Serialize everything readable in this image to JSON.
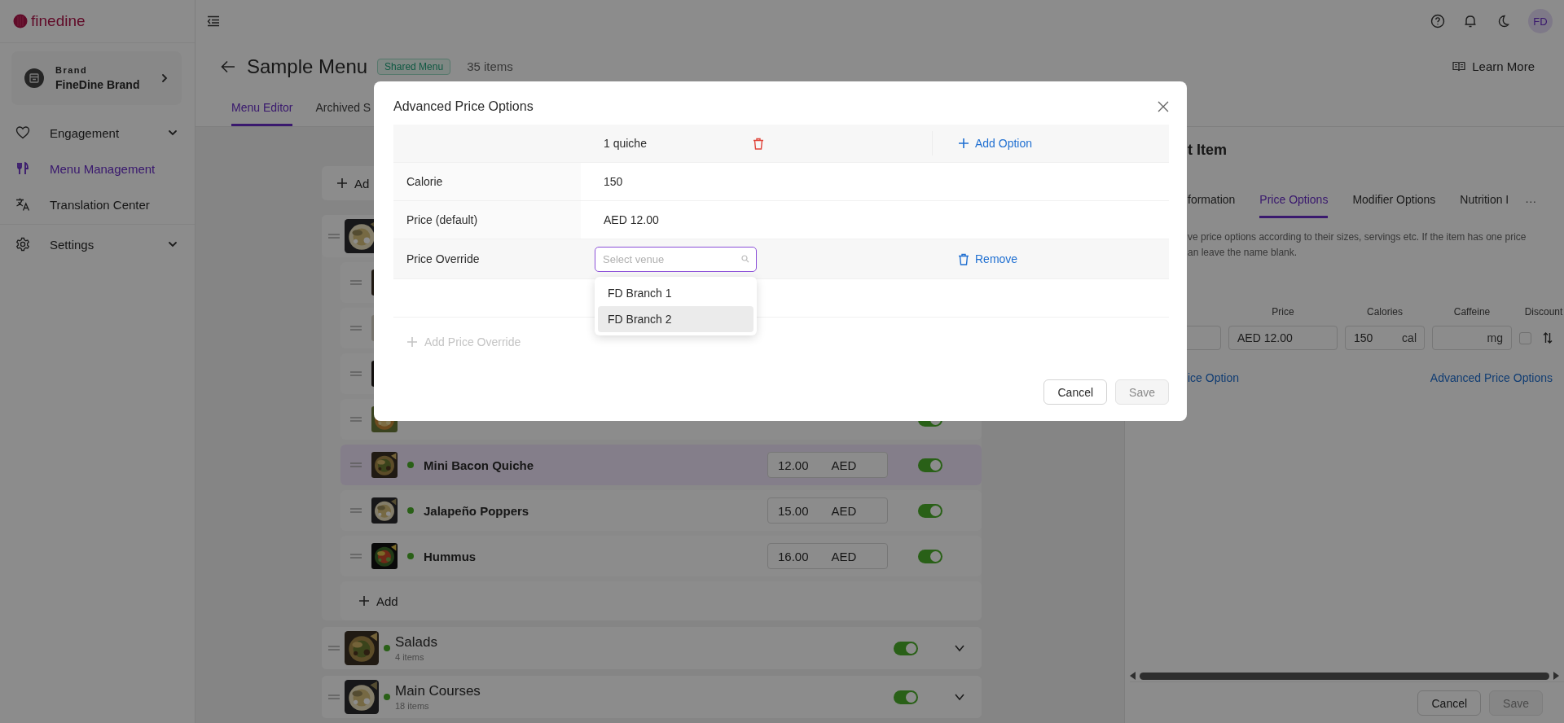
{
  "sidebar": {
    "logo": "finedine",
    "brand": {
      "label": "Brand",
      "name": "FineDine Brand"
    },
    "nav": [
      {
        "label": "Engagement",
        "expandable": true,
        "selected": false
      },
      {
        "label": "Menu Management",
        "expandable": false,
        "selected": true
      },
      {
        "label": "Translation Center",
        "expandable": false,
        "selected": false
      },
      {
        "label": "Settings",
        "expandable": true,
        "selected": false
      }
    ]
  },
  "topbar": {
    "avatar": "FD"
  },
  "header": {
    "title": "Sample Menu",
    "badge": "Shared Menu",
    "count": "35 items",
    "learn_more": "Learn More"
  },
  "tabs": [
    {
      "label": "Menu Editor",
      "selected": true
    },
    {
      "label": "Archived S",
      "selected": false
    }
  ],
  "menu": {
    "add_label": "Ad",
    "categories": [
      {
        "expanded": true,
        "add_label": "Add",
        "children": [
          {
            "kind": "item",
            "selected": false
          },
          {
            "kind": "item",
            "selected": false
          },
          {
            "kind": "item",
            "selected": false
          },
          {
            "kind": "item",
            "selected": false,
            "on": true
          },
          {
            "kind": "item",
            "name": "Mini Bacon Quiche",
            "price": "12.00",
            "currency": "AED",
            "on": true,
            "selected": true
          },
          {
            "kind": "item",
            "name": "Jalapeño Poppers",
            "price": "15.00",
            "currency": "AED",
            "on": true,
            "selected": false
          },
          {
            "kind": "item",
            "name": "Hummus",
            "price": "16.00",
            "currency": "AED",
            "on": true,
            "selected": false
          }
        ]
      },
      {
        "name": "Salads",
        "count": "4 items",
        "on": true,
        "expanded": false
      },
      {
        "name": "Main Courses",
        "count": "18 items",
        "on": true,
        "expanded": false
      }
    ]
  },
  "item_panel": {
    "title": "t Item",
    "tabs": [
      {
        "label": "formation",
        "selected": false
      },
      {
        "label": "Price Options",
        "selected": true
      },
      {
        "label": "Modifier Options",
        "selected": false
      },
      {
        "label": "Nutrition I",
        "selected": false
      }
    ],
    "more": "···",
    "description_lines": [
      "ve price options according to their sizes, servings etc. If the item has one price",
      "an leave the name blank."
    ],
    "columns": [
      "Price",
      "Calories",
      "Caffeine",
      "Discount"
    ],
    "option": {
      "price": "AED 12.00",
      "calories": "150",
      "calories_unit": "cal",
      "caffeine_unit": "mg",
      "discount": false
    },
    "add_link": "ice Option",
    "advanced_link": "Advanced Price Options",
    "cancel": "Cancel",
    "save": {
      "label": "Save",
      "disabled": true
    }
  },
  "modal": {
    "title": "Advanced Price Options",
    "option_name": "1 quiche",
    "add_option": "Add Option",
    "rows": [
      {
        "label": "Calorie",
        "value": "150"
      },
      {
        "label": "Price (default)",
        "value": "AED 12.00"
      }
    ],
    "override": {
      "label": "Price Override",
      "placeholder": "Select venue",
      "remove": "Remove",
      "options": [
        {
          "label": "FD Branch 1",
          "hovered": false
        },
        {
          "label": "FD Branch 2",
          "hovered": true
        }
      ]
    },
    "add_override": {
      "label": "Add Price Override",
      "disabled": true
    },
    "cancel": "Cancel",
    "save": {
      "label": "Save",
      "disabled": true
    }
  }
}
